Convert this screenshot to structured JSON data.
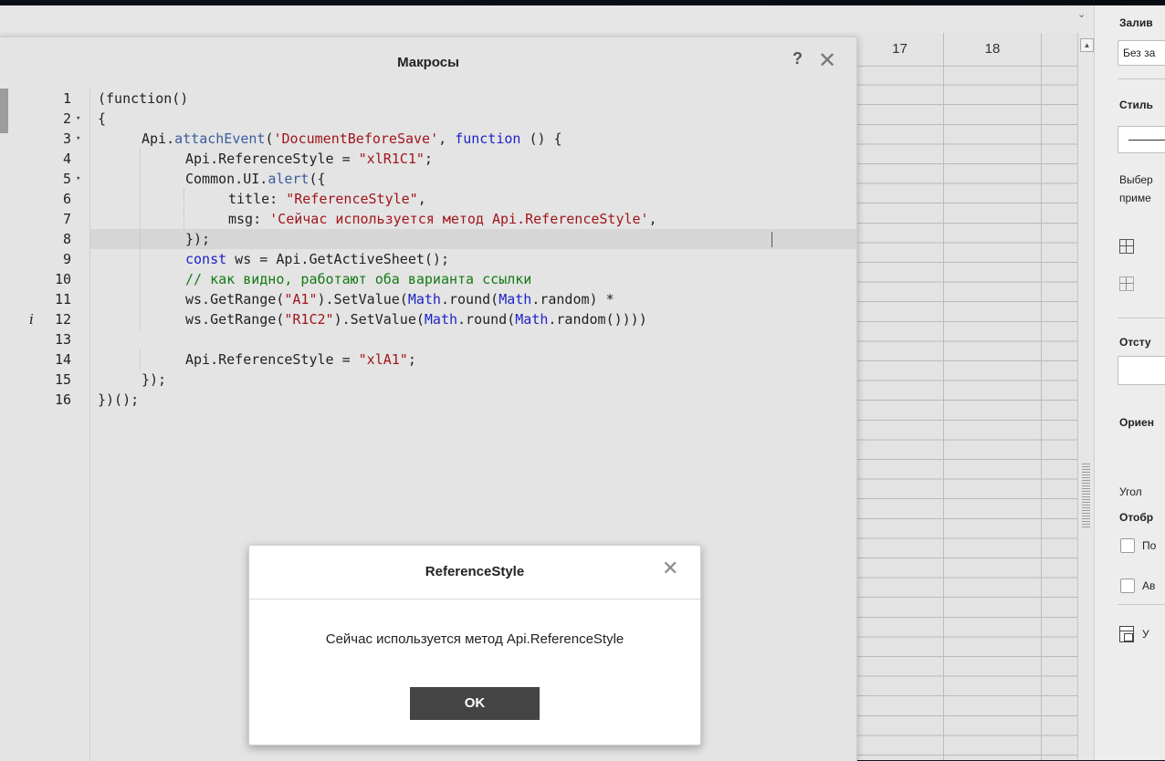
{
  "sheet": {
    "columns": [
      "17",
      "18"
    ]
  },
  "right_panel": {
    "fill_heading": "Залив",
    "fill_value": "Без за",
    "style_heading": "Стиль",
    "select_hint_line1": "Выбер",
    "select_hint_line2": "приме",
    "indent_heading": "Отсту",
    "orientation_heading": "Ориен",
    "angle_label": "Угол",
    "display_heading": "Отобр",
    "checkbox1_label": "По",
    "checkbox2_label": "Ав",
    "bottom_item_label": "У"
  },
  "macros_dialog": {
    "title": "Макросы",
    "help_label": "?",
    "close_icon": "close-icon",
    "line_numbers": [
      "1",
      "2",
      "3",
      "4",
      "5",
      "6",
      "7",
      "8",
      "9",
      "10",
      "11",
      "12",
      "13",
      "14",
      "15",
      "16"
    ],
    "info_marker": "i",
    "code": {
      "l1": "(function()",
      "l2": "{",
      "l3_a": "Api.",
      "l3_b": "attachEvent",
      "l3_c": "(",
      "l3_d": "'DocumentBeforeSave'",
      "l3_e": ", ",
      "l3_f": "function",
      "l3_g": " () {",
      "l4_a": "Api.ReferenceStyle = ",
      "l4_b": "\"xlR1C1\"",
      "l4_c": ";",
      "l5_a": "Common.UI.",
      "l5_b": "alert",
      "l5_c": "({",
      "l6_a": "title: ",
      "l6_b": "\"ReferenceStyle\"",
      "l6_c": ",",
      "l7_a": "msg: ",
      "l7_b": "'Сейчас используется метод Api.ReferenceStyle'",
      "l7_c": ",",
      "l8": "});",
      "l9_a": "const",
      "l9_b": " ws = Api.GetActiveSheet();",
      "l10": "// как видно, работают оба варианта ссылки",
      "l11_a": "ws.GetRange(",
      "l11_b": "\"A1\"",
      "l11_c": ").SetValue(",
      "l11_d": "Math",
      "l11_e": ".round(",
      "l11_f": "Math",
      "l11_g": ".random) *",
      "l12_a": "ws.GetRange(",
      "l12_b": "\"R1C2\"",
      "l12_c": ").SetValue(",
      "l12_d": "Math",
      "l12_e": ".round(",
      "l12_f": "Math",
      "l12_g": ".random())))",
      "l14_a": "Api.ReferenceStyle = ",
      "l14_b": "\"xlA1\"",
      "l14_c": ";",
      "l15": "});",
      "l16": "})();"
    }
  },
  "alert_dialog": {
    "title": "ReferenceStyle",
    "message": "Сейчас используется метод Api.ReferenceStyle",
    "ok_label": "OK"
  },
  "colors": {
    "keyword": "#1f23c7",
    "string": "#a1161c",
    "comment": "#157a15",
    "ok_button": "#444444"
  }
}
